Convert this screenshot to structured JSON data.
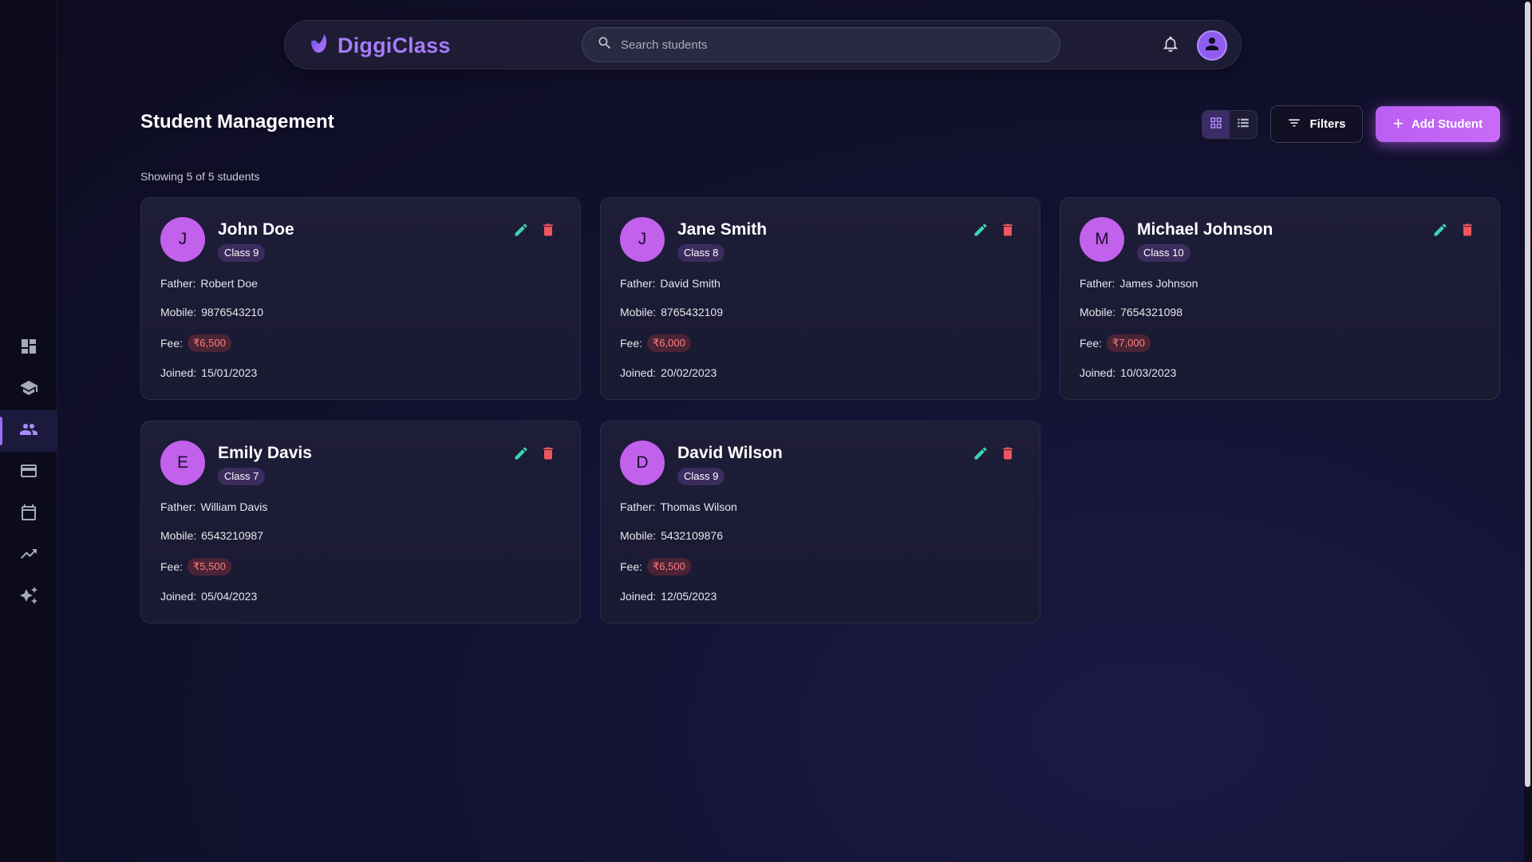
{
  "app": {
    "brand_name": "DiggiClass",
    "brand_color": "#a57cf7",
    "accent_color": "#c261ec"
  },
  "search": {
    "placeholder": "Search students",
    "value": ""
  },
  "sidebar": {
    "items": [
      {
        "name": "dashboard",
        "icon": "dashboard-icon",
        "active": false
      },
      {
        "name": "classes",
        "icon": "graduation-cap-icon",
        "active": false
      },
      {
        "name": "students",
        "icon": "people-icon",
        "active": true
      },
      {
        "name": "payments",
        "icon": "credit-card-icon",
        "active": false
      },
      {
        "name": "calendar",
        "icon": "calendar-icon",
        "active": false
      },
      {
        "name": "analytics",
        "icon": "trending-up-icon",
        "active": false
      },
      {
        "name": "ai-tools",
        "icon": "sparkles-icon",
        "active": false
      }
    ]
  },
  "header": {
    "title": "Student Management",
    "filters_label": "Filters",
    "add_label": "Add Student",
    "view_mode": "grid"
  },
  "summary": {
    "showing_text": "Showing 5 of 5 students"
  },
  "labels": {
    "father": "Father:",
    "mobile": "Mobile:",
    "fee": "Fee:",
    "joined": "Joined:"
  },
  "students": [
    {
      "initial": "J",
      "name": "John Doe",
      "class": "Class 9",
      "father": "Robert Doe",
      "mobile": "9876543210",
      "fee": "₹6,500",
      "joined": "15/01/2023"
    },
    {
      "initial": "J",
      "name": "Jane Smith",
      "class": "Class 8",
      "father": "David Smith",
      "mobile": "8765432109",
      "fee": "₹6,000",
      "joined": "20/02/2023"
    },
    {
      "initial": "M",
      "name": "Michael Johnson",
      "class": "Class 10",
      "father": "James Johnson",
      "mobile": "7654321098",
      "fee": "₹7,000",
      "joined": "10/03/2023"
    },
    {
      "initial": "E",
      "name": "Emily Davis",
      "class": "Class 7",
      "father": "William Davis",
      "mobile": "6543210987",
      "fee": "₹5,500",
      "joined": "05/04/2023"
    },
    {
      "initial": "D",
      "name": "David Wilson",
      "class": "Class 9",
      "father": "Thomas Wilson",
      "mobile": "5432109876",
      "fee": "₹6,500",
      "joined": "12/05/2023"
    }
  ]
}
